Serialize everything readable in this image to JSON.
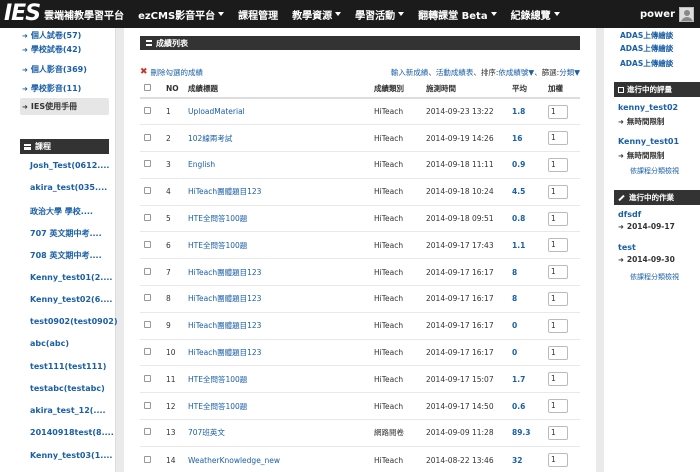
{
  "nav": {
    "logo": "IES",
    "brand": "雲端補教學習平台",
    "items": [
      {
        "label": "ezCMS影音平台",
        "caret": true
      },
      {
        "label": "課程管理",
        "caret": false
      },
      {
        "label": "教學資源",
        "caret": true
      },
      {
        "label": "學習活動",
        "caret": true
      },
      {
        "label": "翻轉課堂 Beta",
        "caret": true
      },
      {
        "label": "紀錄總覽",
        "caret": true
      }
    ],
    "user": "power"
  },
  "left": {
    "links": [
      {
        "label": "個人試卷(57)"
      },
      {
        "label": "學校試卷(42)"
      },
      {
        "label": "個人影音(369)"
      },
      {
        "label": "學校影音(11)"
      },
      {
        "label": "IES使用手冊"
      }
    ],
    "courses_header": "課程",
    "courses": [
      "Josh_Test(0612....",
      "akira_test(035....",
      "政治大學 學校....",
      "707 英文期中考....",
      "708 英文期中考....",
      "Kenny_test01(2....",
      "Kenny_test02(6....",
      "test0902(test0902)",
      "abc(abc)",
      "test111(test111)",
      "testabc(testabc)",
      "akira_test_12(....",
      "20140918test(8....",
      "Kenny_test03(1...."
    ]
  },
  "main": {
    "panel_title": "成績列表",
    "delete_link": "刪除勾選的成績",
    "toolbar": {
      "new_grade": "輸入新成績",
      "activity_sheet": "活動成績表",
      "sort_label": "排序:",
      "sort_value": "依成績號",
      "filter_label": "篩選:",
      "filter_value": "分類"
    },
    "columns": {
      "no": "NO",
      "title": "成績標題",
      "category": "成績類別",
      "time": "施測時間",
      "avg": "平均",
      "weight": "加權"
    },
    "rows": [
      {
        "no": "1",
        "title": "UploadMaterial",
        "category": "HiTeach",
        "time": "2014-09-23 13:22",
        "avg": "1.8",
        "weight": "1"
      },
      {
        "no": "2",
        "title": "102線兩考試",
        "category": "HiTeach",
        "time": "2014-09-19 14:26",
        "avg": "16",
        "weight": "1"
      },
      {
        "no": "3",
        "title": "English",
        "category": "HiTeach",
        "time": "2014-09-18 11:11",
        "avg": "0.9",
        "weight": "1"
      },
      {
        "no": "4",
        "title": "HiTeach團體題目123",
        "category": "HiTeach",
        "time": "2014-09-18 10:24",
        "avg": "4.5",
        "weight": "1"
      },
      {
        "no": "5",
        "title": "HTE全問答100題",
        "category": "HiTeach",
        "time": "2014-09-18 09:51",
        "avg": "0.8",
        "weight": "1"
      },
      {
        "no": "6",
        "title": "HTE全問答100題",
        "category": "HiTeach",
        "time": "2014-09-17 17:43",
        "avg": "1.1",
        "weight": "1"
      },
      {
        "no": "7",
        "title": "HiTeach團體題目123",
        "category": "HiTeach",
        "time": "2014-09-17 16:17",
        "avg": "8",
        "weight": "1"
      },
      {
        "no": "8",
        "title": "HiTeach團體題目123",
        "category": "HiTeach",
        "time": "2014-09-17 16:17",
        "avg": "8",
        "weight": "1"
      },
      {
        "no": "9",
        "title": "HiTeach團體題目123",
        "category": "HiTeach",
        "time": "2014-09-17 16:17",
        "avg": "0",
        "weight": "1"
      },
      {
        "no": "10",
        "title": "HiTeach團體題目123",
        "category": "HiTeach",
        "time": "2014-09-17 16:17",
        "avg": "0",
        "weight": "1"
      },
      {
        "no": "11",
        "title": "HTE全問答100題",
        "category": "HiTeach",
        "time": "2014-09-17 15:07",
        "avg": "1.7",
        "weight": "1"
      },
      {
        "no": "12",
        "title": "HTE全問答100題",
        "category": "HiTeach",
        "time": "2014-09-17 14:50",
        "avg": "0.6",
        "weight": "1"
      },
      {
        "no": "13",
        "title": "707班英文",
        "category": "網路閱卷",
        "time": "2014-09-09 11:28",
        "avg": "89.3",
        "weight": "1"
      },
      {
        "no": "14",
        "title": "WeatherKnowledge_new",
        "category": "HiTeach",
        "time": "2014-08-22 13:46",
        "avg": "32",
        "weight": "1"
      }
    ]
  },
  "right": {
    "top_links": [
      "ADAS上傳繪談",
      "ADAS上傳繪談",
      "ADAS上傳繪談"
    ],
    "eval_header": "進行中的評量",
    "evals": [
      {
        "name": "kenny_test02",
        "limit": "無時間限制"
      },
      {
        "name": "Kenny_test01",
        "limit": "無時間限制"
      }
    ],
    "eval_more": "依課程分類檢視",
    "hw_header": "進行中的作業",
    "homeworks": [
      {
        "name": "dfsdf",
        "date": "2014-09-17"
      },
      {
        "name": "test",
        "date": "2014-09-30"
      }
    ],
    "hw_more": "依課程分類檢視"
  }
}
